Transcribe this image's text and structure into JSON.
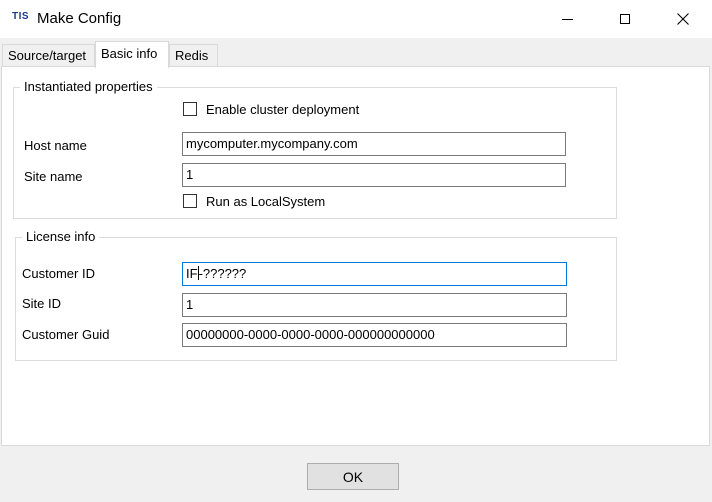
{
  "window": {
    "app_icon_text": "TIS",
    "title": "Make Config",
    "icons": {
      "minimize": "minimize-icon",
      "maximize": "maximize-icon",
      "close": "close-icon"
    }
  },
  "tabs": [
    {
      "label": "Source/target",
      "selected": false
    },
    {
      "label": "Basic info",
      "selected": true
    },
    {
      "label": "Redis",
      "selected": false
    }
  ],
  "instantiated": {
    "title": "Instantiated properties",
    "enable_cluster": {
      "label": "Enable cluster deployment",
      "checked": false
    },
    "host_name": {
      "label": "Host name",
      "value": "mycomputer.mycompany.com"
    },
    "site_name": {
      "label": "Site name",
      "value": "1"
    },
    "run_as_localsystem": {
      "label": "Run as LocalSystem",
      "checked": false
    }
  },
  "license": {
    "title": "License info",
    "customer_id": {
      "label": "Customer ID",
      "value_before_caret": "IF",
      "value_after_caret": "-??????"
    },
    "site_id": {
      "label": "Site ID",
      "value": "1"
    },
    "customer_guid": {
      "label": "Customer Guid",
      "value": "00000000-0000-0000-0000-000000000000"
    }
  },
  "footer": {
    "ok_label": "OK"
  },
  "colors": {
    "accent_focus": "#0078d7",
    "app_icon": "#1a3a8f"
  }
}
